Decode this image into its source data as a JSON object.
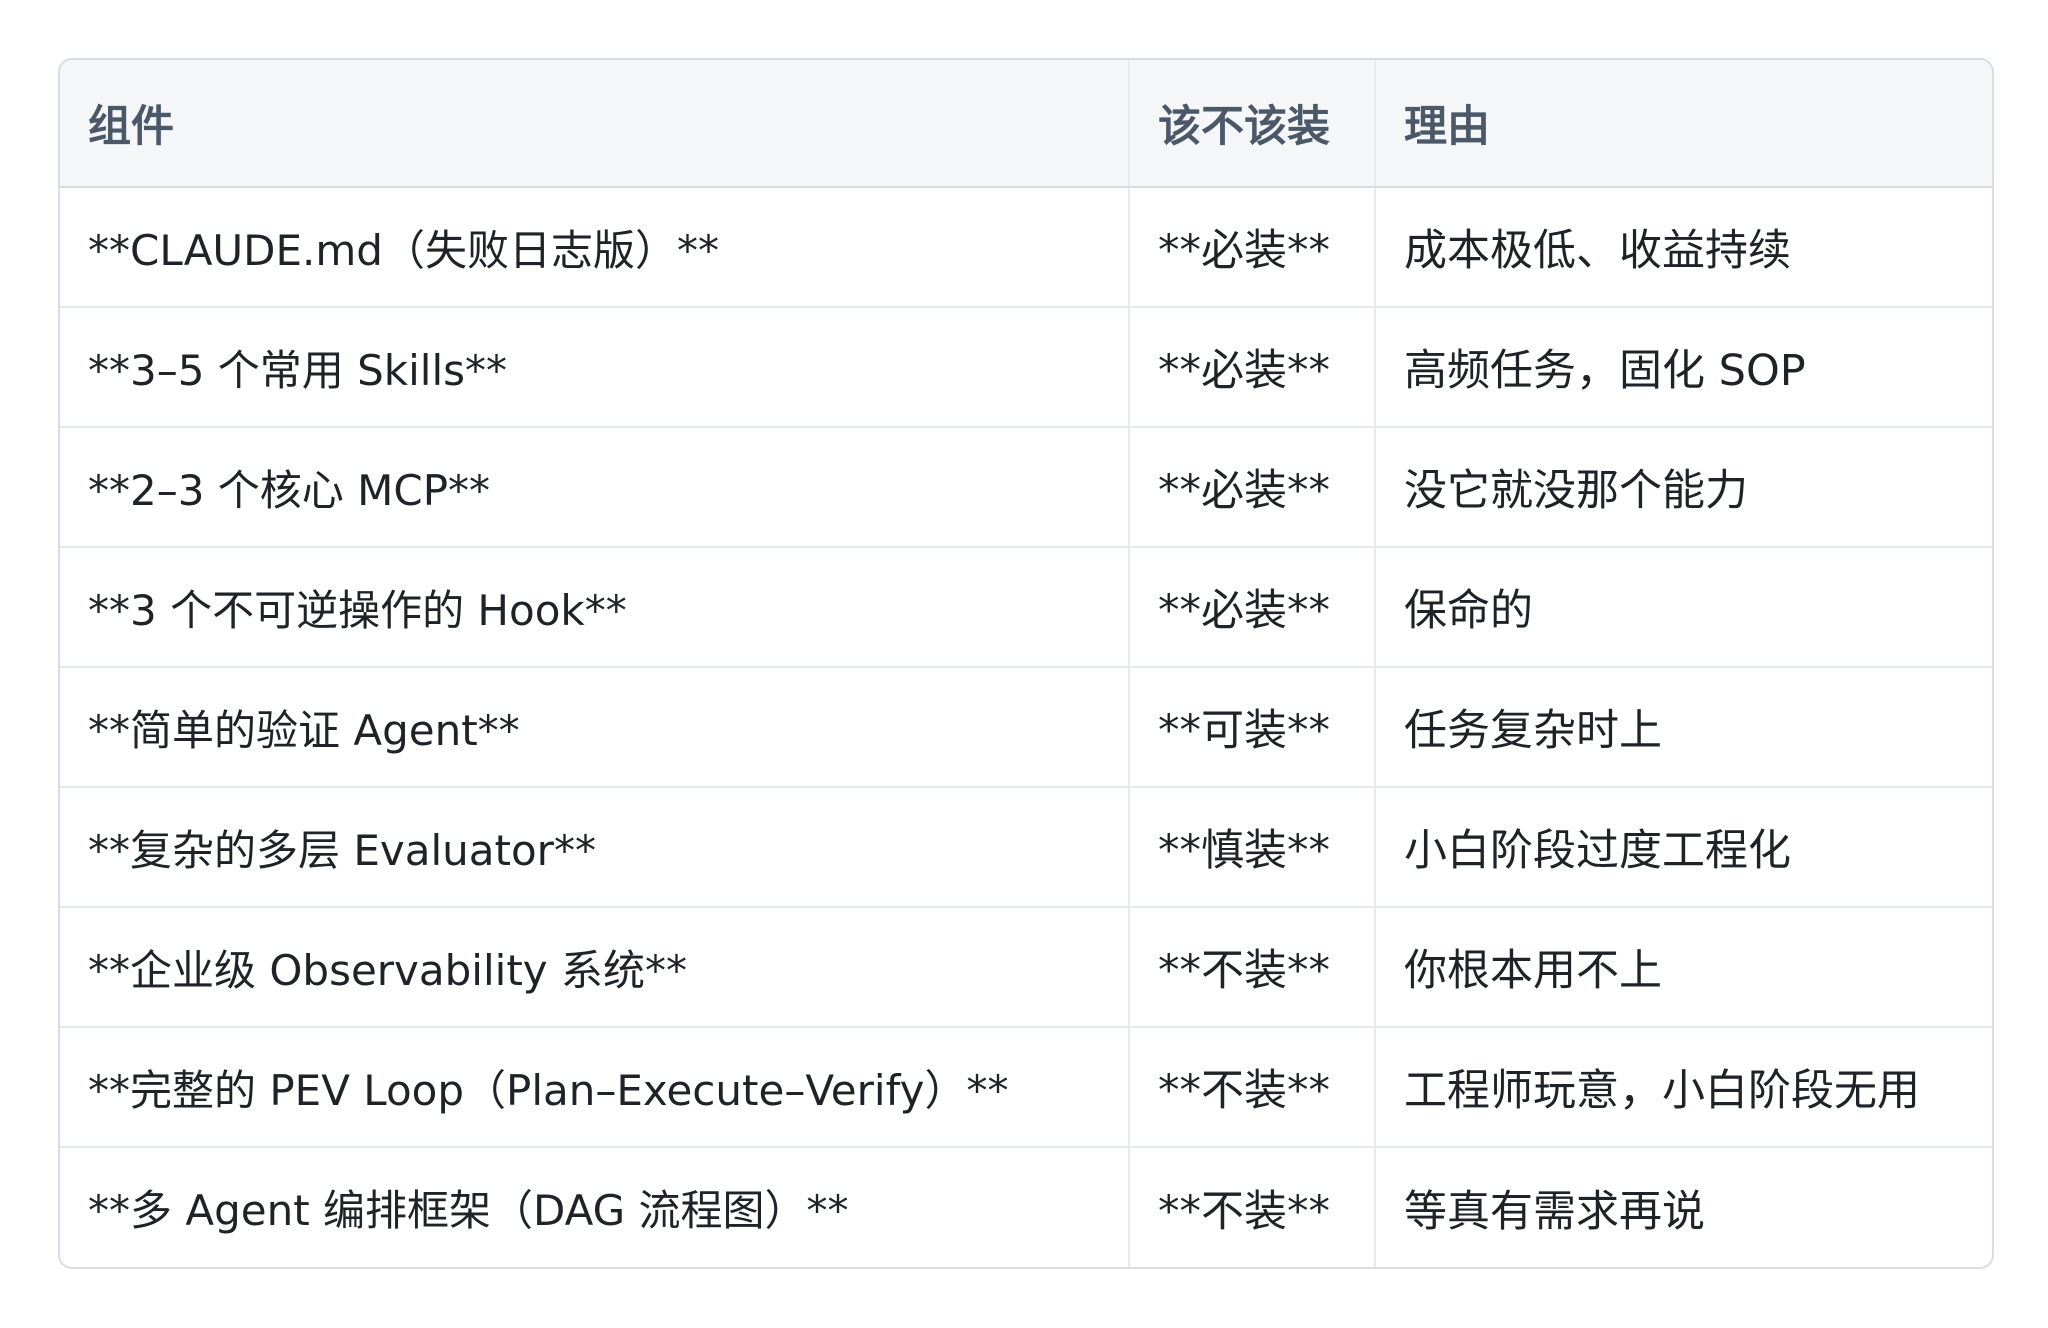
{
  "table": {
    "headers": [
      "组件",
      "该不该装",
      "理由"
    ],
    "rows": [
      [
        "**CLAUDE.md（失败日志版）**",
        "**必装**",
        "成本极低、收益持续"
      ],
      [
        "**3–5 个常用 Skills**",
        "**必装**",
        "高频任务，固化 SOP"
      ],
      [
        "**2–3 个核心 MCP**",
        "**必装**",
        "没它就没那个能力"
      ],
      [
        "**3 个不可逆操作的 Hook**",
        "**必装**",
        "保命的"
      ],
      [
        "**简单的验证 Agent**",
        "**可装**",
        "任务复杂时上"
      ],
      [
        "**复杂的多层 Evaluator**",
        "**慎装**",
        "小白阶段过度工程化"
      ],
      [
        "**企业级 Observability 系统**",
        "**不装**",
        "你根本用不上"
      ],
      [
        "**完整的 PEV Loop（Plan–Execute–Verify）**",
        "**不装**",
        "工程师玩意，小白阶段无用"
      ],
      [
        "**多 Agent 编排框架（DAG 流程图）**",
        "**不装**",
        "等真有需求再说"
      ]
    ]
  }
}
